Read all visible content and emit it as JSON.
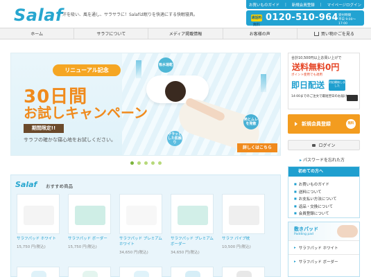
{
  "header": {
    "logo": "Salaf",
    "tagline": "汗を吸い、風を通し、サラサラに！Salafは眠りを快適にする快眠寝具。",
    "toplinks": [
      "お買いものガイド",
      "新規会員登録",
      "マイページログイン"
    ],
    "phone_badge": "通話料無料",
    "phone_number": "0120-510-964",
    "phone_hours_1": "受付時間",
    "phone_hours_2": "平日 9:00〜17:00"
  },
  "nav": {
    "items": [
      "ホーム",
      "サラフについて",
      "メディア掲載情報",
      "お客様の声",
      "買い物かごを見る"
    ]
  },
  "hero": {
    "renewal": "リニューアル記念",
    "big1": "30日間",
    "big2": "お試しキャンペーン",
    "limited": "期間限定!!",
    "desc": "サラフの確かな寝心地をお試しください。",
    "bubble1": "吸水速乾",
    "bubble2": "サラッとした肌触り",
    "bubble3": "熱とムレを発散",
    "detail": "詳しくはこちら",
    "dots_total": 5,
    "dots_active": 1
  },
  "promo": {
    "line1": "合計10,500円以上お買い上げで",
    "free_shipping": "送料無料0円",
    "line2": "ポイント使用でも適用",
    "same_day": "即日配送",
    "badge": "対応開始しました",
    "line3": "14:00までのご注文で最短翌日のお届け"
  },
  "register": {
    "label": "新規会員登録",
    "free": "無料"
  },
  "login": {
    "label": "ログイン"
  },
  "forgot": {
    "label": "パスワードを忘れた方"
  },
  "guide": {
    "title": "初めての方へ",
    "items": [
      "お買いものガイド",
      "送料について",
      "お支払い方法について",
      "返品・交換について",
      "会員登録について"
    ]
  },
  "pad": {
    "title": "敷きパッド",
    "subtitle": "Padding pad",
    "items": [
      "サラフパッド ホワイト",
      "サラフパッド ボーダー"
    ]
  },
  "rec": {
    "logo": "Salaf",
    "title": "おすすめ商品",
    "products": [
      {
        "name": "サラフパッド ホワイト",
        "price": "15,750 円(税込)",
        "color": "#f4f4f4"
      },
      {
        "name": "サラフパッド ボーダー",
        "price": "15,750 円(税込)",
        "color": "#cfeee6"
      },
      {
        "name": "サラフパッド プレミアム ホワイト",
        "price": "34,650 円(税込)",
        "color": "#f7f7f7"
      },
      {
        "name": "サラフパッド プレミアム ボーダー",
        "price": "34,650 円(税込)",
        "color": "#d2efe8"
      },
      {
        "name": "サラフ パイプ枕",
        "price": "10,500 円(税込)",
        "color": "#efefef"
      }
    ],
    "row2_colors": [
      "#dff2f9",
      "#e4f5ef",
      "#e0f3fa",
      "#d6eef7",
      "#e8e8e8"
    ]
  }
}
